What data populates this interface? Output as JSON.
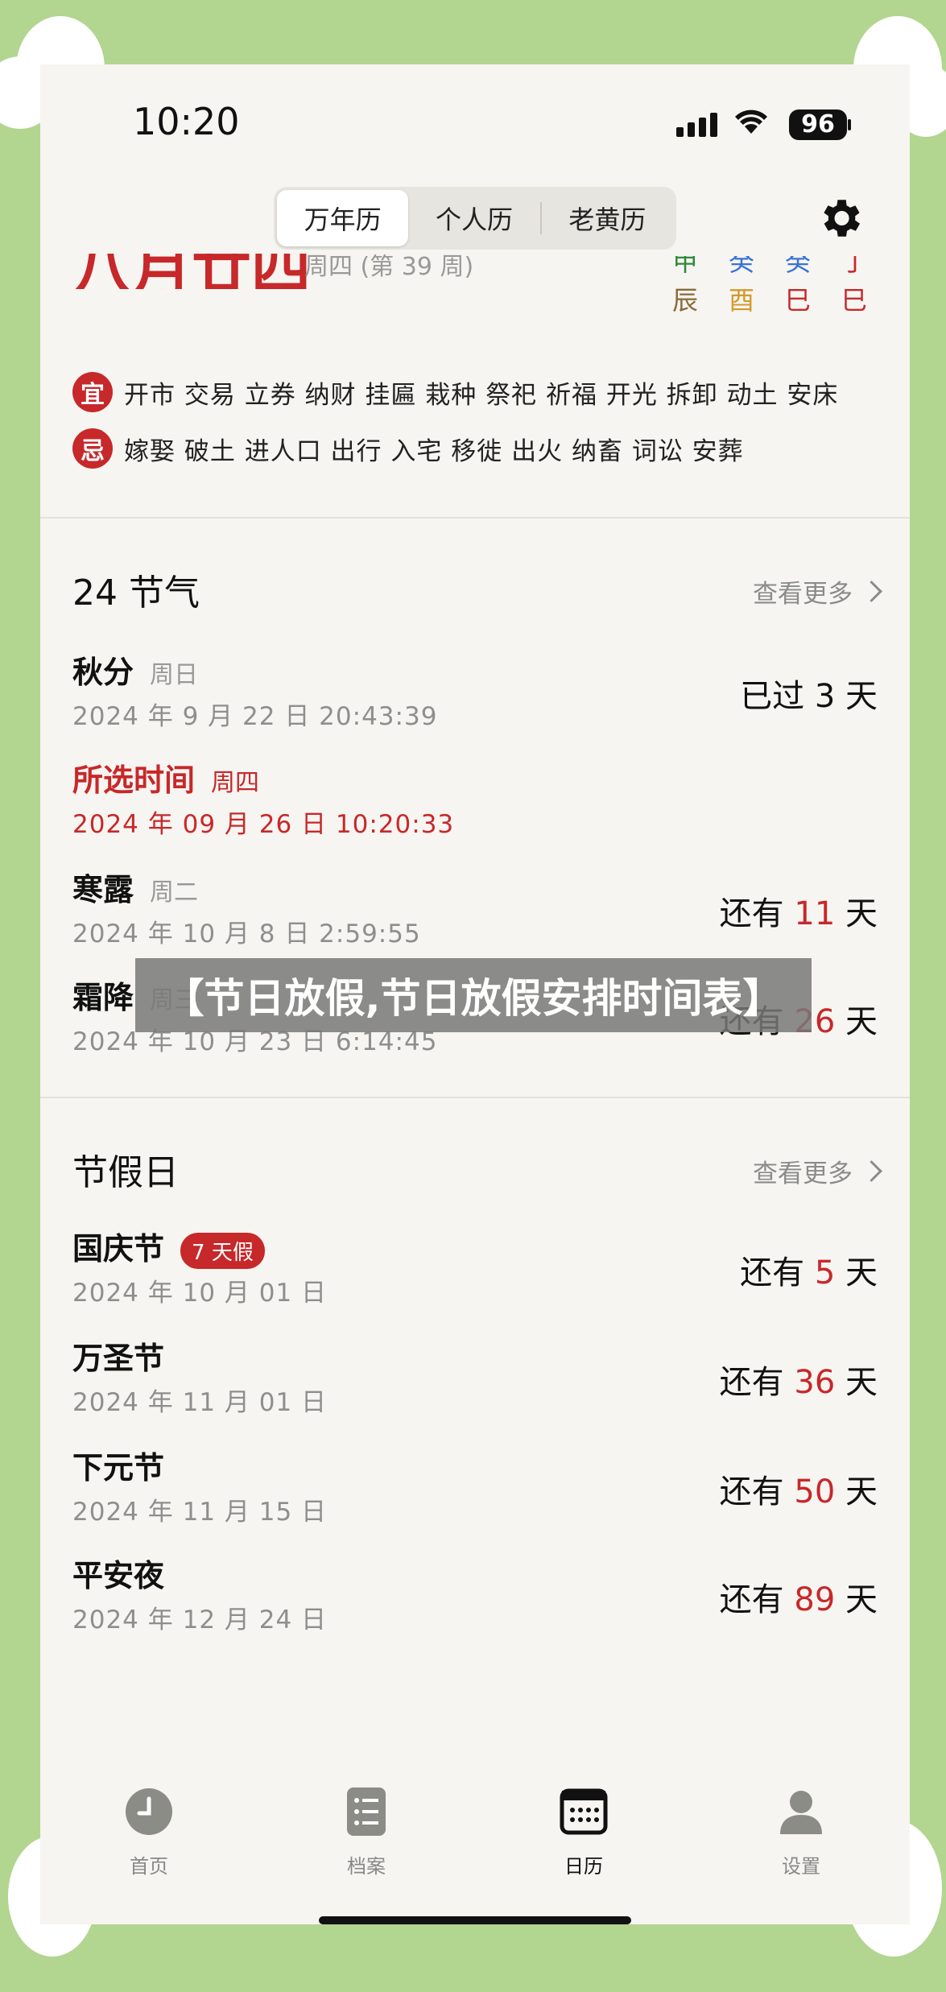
{
  "status_bar": {
    "time": "10:20",
    "battery": "96"
  },
  "segmented": [
    "万年历",
    "个人历",
    "老黄历"
  ],
  "date_header": {
    "lunar_date": "八月廿四",
    "week_info": "周四 (第 39 周)"
  },
  "ganzhi": [
    {
      "top": "甲",
      "bottom": "辰",
      "color": "#2f8a3a",
      "bottom_color": "#8a6a3a"
    },
    {
      "top": "癸",
      "bottom": "酉",
      "color": "#3a72d6",
      "bottom_color": "#d49a2a"
    },
    {
      "top": "癸",
      "bottom": "巳",
      "color": "#3a72d6",
      "bottom_color": "#c7282a"
    },
    {
      "top": "丁",
      "bottom": "巳",
      "color": "#c7282a",
      "bottom_color": "#c7282a"
    }
  ],
  "yi": {
    "badge": "宜",
    "text": "开市 交易 立券 纳财 挂匾 栽种 祭祀 祈福 开光 拆卸 动土 安床"
  },
  "ji": {
    "badge": "忌",
    "text": "嫁娶 破土 进人口 出行 入宅 移徙 出火 纳畜 词讼 安葬"
  },
  "solar_terms": {
    "title": "24 节气",
    "more": "查看更多",
    "items": [
      {
        "name": "秋分",
        "week": "周日",
        "date": "2024 年 9 月 22 日 20:43:39",
        "prefix": "已过",
        "days": "3",
        "suffix": "天",
        "days_red": false
      },
      {
        "name": "所选时间",
        "week": "周四",
        "date": "2024 年 09 月 26 日 10:20:33",
        "prefix": "",
        "days": "",
        "suffix": "",
        "days_red": false
      },
      {
        "name": "寒露",
        "week": "周二",
        "date": "2024 年 10 月 8 日 2:59:55",
        "prefix": "还有",
        "days": "11",
        "suffix": "天",
        "days_red": true
      },
      {
        "name": "霜降",
        "week": "周三",
        "date": "2024 年 10 月 23 日 6:14:45",
        "prefix": "还有",
        "days": "26",
        "suffix": "天",
        "days_red": true
      }
    ]
  },
  "holidays": {
    "title": "节假日",
    "more": "查看更多",
    "items": [
      {
        "name": "国庆节",
        "badge": "7 天假",
        "date": "2024 年 10 月 01 日",
        "prefix": "还有",
        "days": "5",
        "suffix": "天"
      },
      {
        "name": "万圣节",
        "badge": "",
        "date": "2024 年 11 月 01 日",
        "prefix": "还有",
        "days": "36",
        "suffix": "天"
      },
      {
        "name": "下元节",
        "badge": "",
        "date": "2024 年 11 月 15 日",
        "prefix": "还有",
        "days": "50",
        "suffix": "天"
      },
      {
        "name": "平安夜",
        "badge": "",
        "date": "2024 年 12 月 24 日",
        "prefix": "还有",
        "days": "89",
        "suffix": "天"
      }
    ]
  },
  "overlay_title": "【节日放假,节日放假安排时间表】",
  "tabbar": [
    {
      "label": "首页",
      "icon": "clock-icon",
      "active": false
    },
    {
      "label": "档案",
      "icon": "list-icon",
      "active": false
    },
    {
      "label": "日历",
      "icon": "calendar-icon",
      "active": true
    },
    {
      "label": "设置",
      "icon": "person-icon",
      "active": false
    }
  ],
  "colors": {
    "accent": "#c7282a",
    "background": "#b2d58f",
    "panel": "#f6f5f1"
  }
}
